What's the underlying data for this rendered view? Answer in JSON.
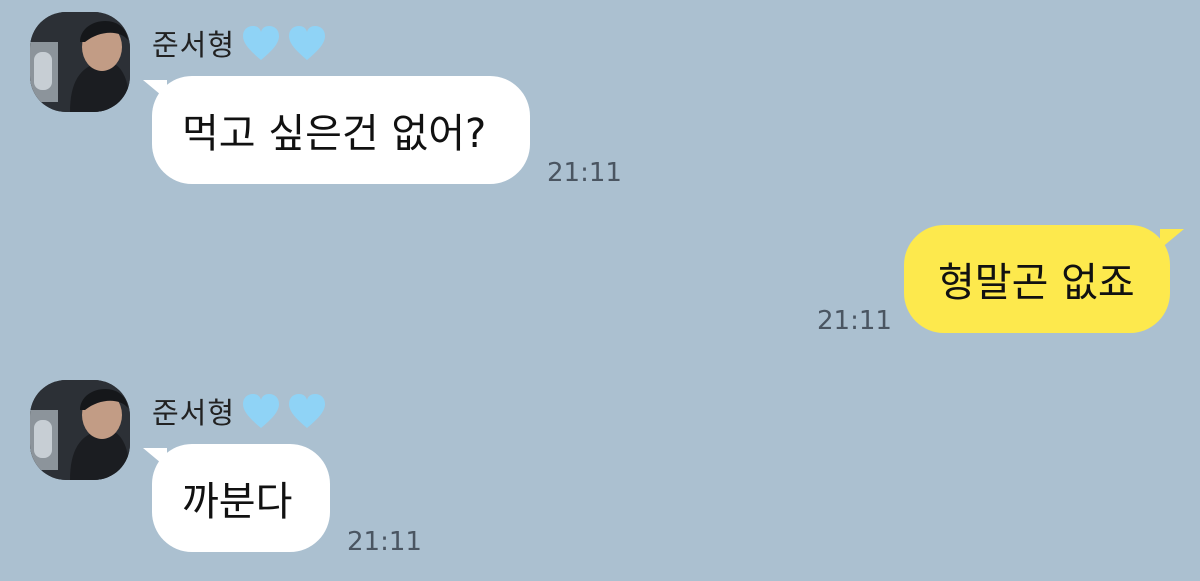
{
  "messages": [
    {
      "direction": "incoming",
      "sender": "준서형",
      "sender_hearts": [
        "light-blue-heart-icon",
        "light-blue-heart-icon"
      ],
      "text": "먹고 싶은건 없어?",
      "time": "21:11"
    },
    {
      "direction": "outgoing",
      "text": "형말곤 없죠",
      "time": "21:11"
    },
    {
      "direction": "incoming",
      "sender": "준서형",
      "sender_hearts": [
        "light-blue-heart-icon",
        "light-blue-heart-icon"
      ],
      "text": "까분다",
      "time": "21:11"
    }
  ],
  "colors": {
    "background": "#abc0d0",
    "incoming_bubble": "#ffffff",
    "outgoing_bubble": "#fde94d",
    "heart": "#8fd3f6"
  }
}
